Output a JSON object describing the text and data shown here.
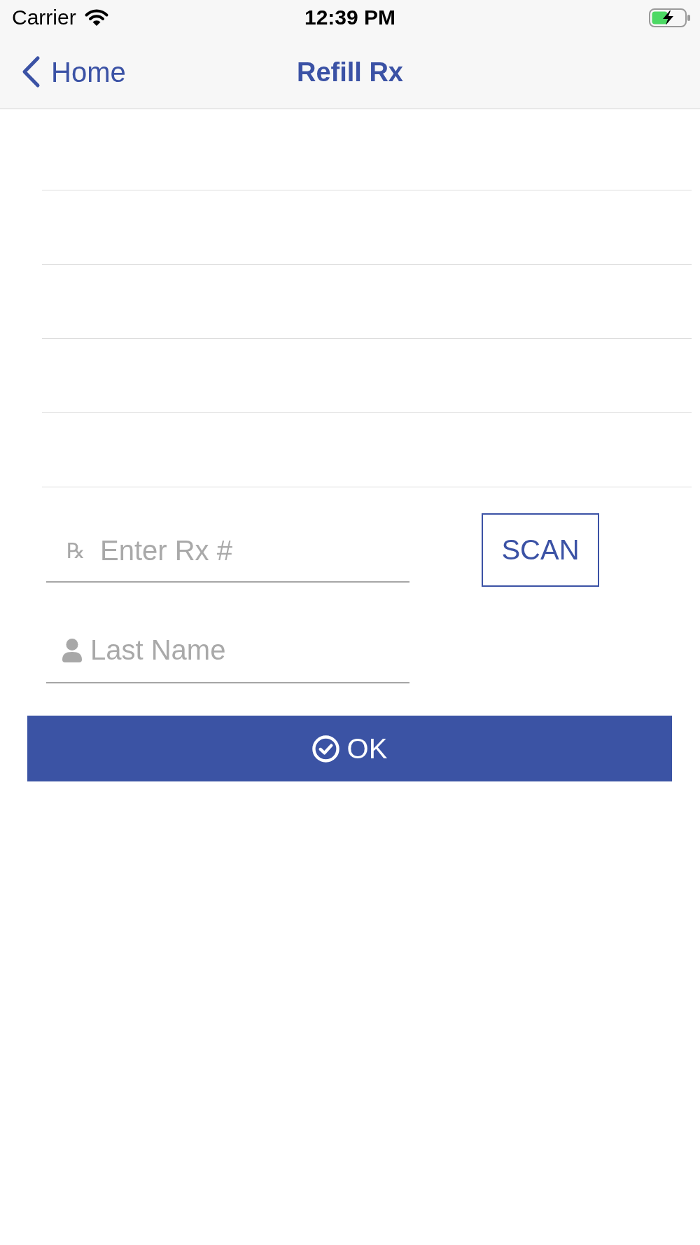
{
  "status_bar": {
    "carrier": "Carrier",
    "time": "12:39 PM",
    "charging": true
  },
  "nav": {
    "back": "Home",
    "title": "Refill Rx"
  },
  "form": {
    "rx_field": {
      "icon": "℞",
      "placeholder": "Enter Rx #"
    },
    "scan_button": "SCAN",
    "name_field": {
      "placeholder": "Last Name"
    },
    "ok_button": "OK"
  }
}
